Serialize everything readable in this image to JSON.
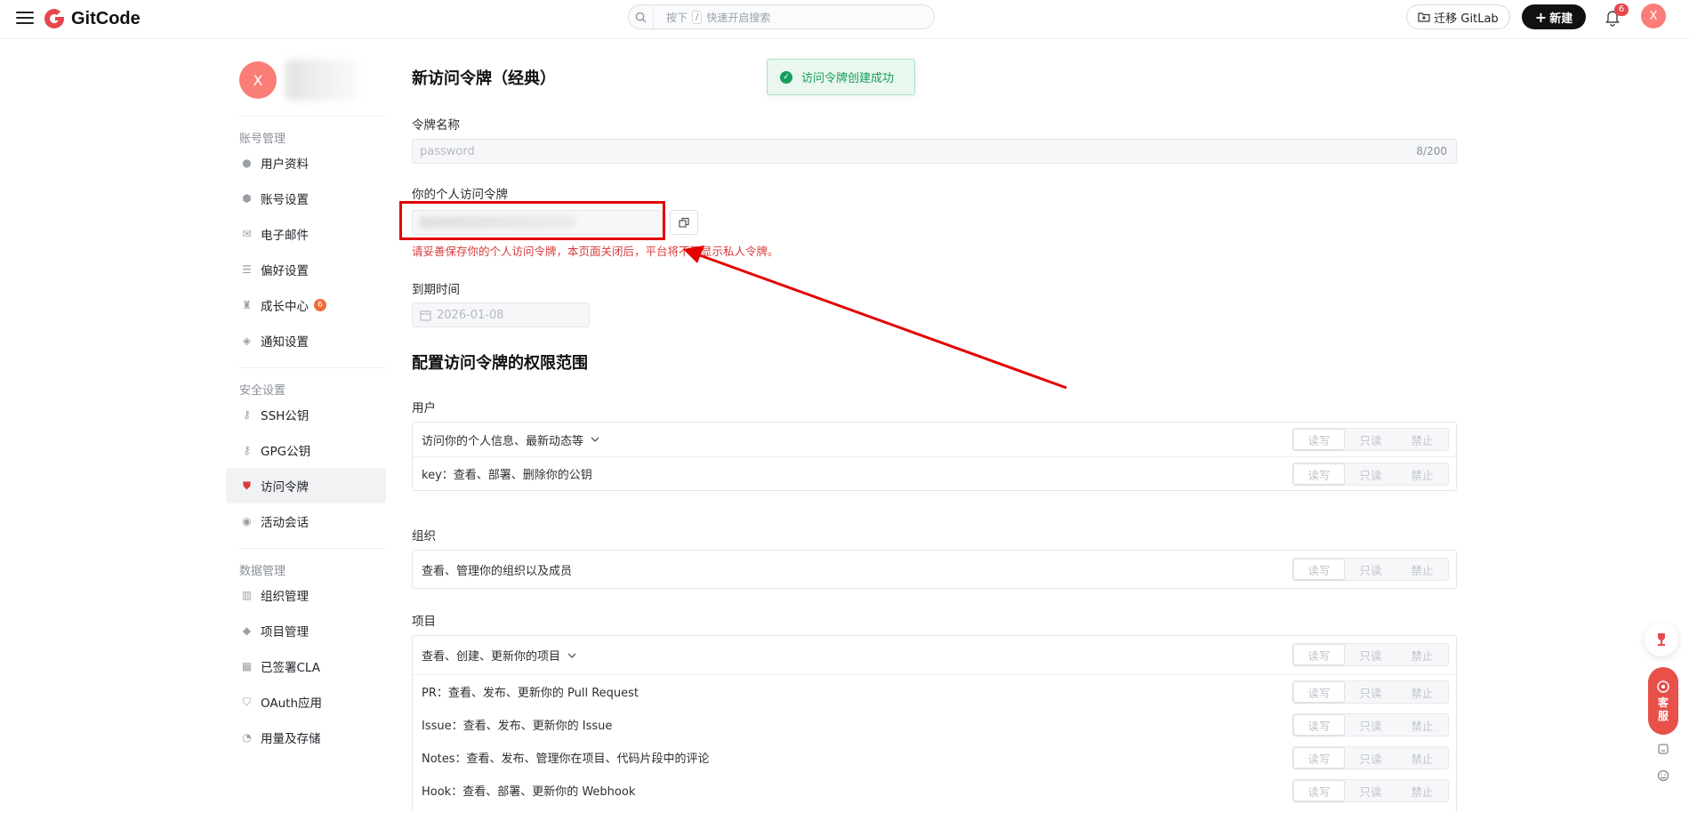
{
  "header": {
    "logo_text": "GitCode",
    "search_prefix": "按下",
    "search_key": "/",
    "search_suffix": "快速开启搜索",
    "migrate_label": "迁移 GitLab",
    "new_label": "新建",
    "notification_count": "6",
    "avatar_initial": "X"
  },
  "sidebar": {
    "avatar_initial": "X",
    "account_title": "账号管理",
    "account_items": [
      "用户资料",
      "账号设置",
      "电子邮件",
      "偏好设置",
      "成长中心",
      "通知设置"
    ],
    "growth_badge": "6",
    "security_title": "安全设置",
    "security_items": [
      "SSH公钥",
      "GPG公钥",
      "访问令牌",
      "活动会话"
    ],
    "data_title": "数据管理",
    "data_items": [
      "组织管理",
      "项目管理",
      "已签署CLA",
      "OAuth应用",
      "用量及存储"
    ]
  },
  "main": {
    "title": "新访问令牌（经典）",
    "token_name_label": "令牌名称",
    "token_name_value": "password",
    "token_name_count": "8/200",
    "personal_token_label": "你的个人访问令牌",
    "warning": "请妥善保存你的个人访问令牌，本页面关闭后，平台将不再显示私人令牌。",
    "expire_label": "到期时间",
    "expire_value": "2026-01-08",
    "scope_title": "配置访问令牌的权限范围",
    "groups": {
      "user_label": "用户",
      "user_rows": [
        "访问你的个人信息、最新动态等",
        "key：查看、部署、删除你的公钥"
      ],
      "org_label": "组织",
      "org_rows": [
        "查看、管理你的组织以及成员"
      ],
      "project_label": "项目",
      "project_rows": [
        "查看、创建、更新你的项目",
        "PR：查看、发布、更新你的 Pull Request",
        "Issue：查看、发布、更新你的 Issue",
        "Notes：查看、发布、管理你在项目、代码片段中的评论",
        "Hook：查看、部署、更新你的 Webhook"
      ]
    },
    "perm_options": [
      "读写",
      "只读",
      "禁止"
    ]
  },
  "toast": {
    "message": "访问令牌创建成功"
  },
  "float": {
    "service_line1": "客",
    "service_line2": "服"
  },
  "colors": {
    "brand_red": "#e5484d",
    "accent_green": "#189e5c",
    "annotation_red": "#e30000"
  }
}
